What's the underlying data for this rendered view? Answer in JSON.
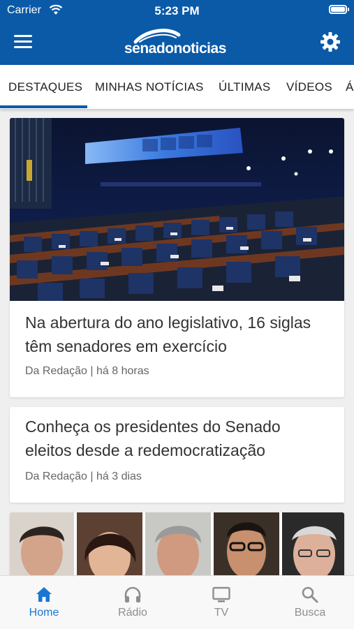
{
  "status_bar": {
    "carrier": "Carrier",
    "time": "5:23 PM"
  },
  "header": {
    "logo_text": "senadonoticias"
  },
  "tabs": [
    {
      "label": "DESTAQUES",
      "active": true
    },
    {
      "label": "MINHAS NOTÍCIAS",
      "active": false
    },
    {
      "label": "ÚLTIMAS",
      "active": false
    },
    {
      "label": "VÍDEOS",
      "active": false
    },
    {
      "label": "Á",
      "active": false
    }
  ],
  "articles": [
    {
      "title": "Na abertura do ano legislativo, 16 siglas têm senadores em exercício",
      "meta": "Da Redação | há 8 horas",
      "image": "senate-plenary-photo"
    },
    {
      "title": "Conheça os presidentes do Senado eleitos desde a redemocratização",
      "meta": "Da Redação | há 3 dias"
    },
    {
      "image": "senate-presidents-portraits"
    }
  ],
  "bottom_nav": [
    {
      "label": "Home",
      "icon": "home-icon",
      "active": true
    },
    {
      "label": "Rádio",
      "icon": "headphones-icon",
      "active": false
    },
    {
      "label": "TV",
      "icon": "tv-icon",
      "active": false
    },
    {
      "label": "Busca",
      "icon": "search-icon",
      "active": false
    }
  ],
  "colors": {
    "brand": "#0a5aa8",
    "active_nav": "#1976d2",
    "inactive_nav": "#8e8e8e"
  }
}
